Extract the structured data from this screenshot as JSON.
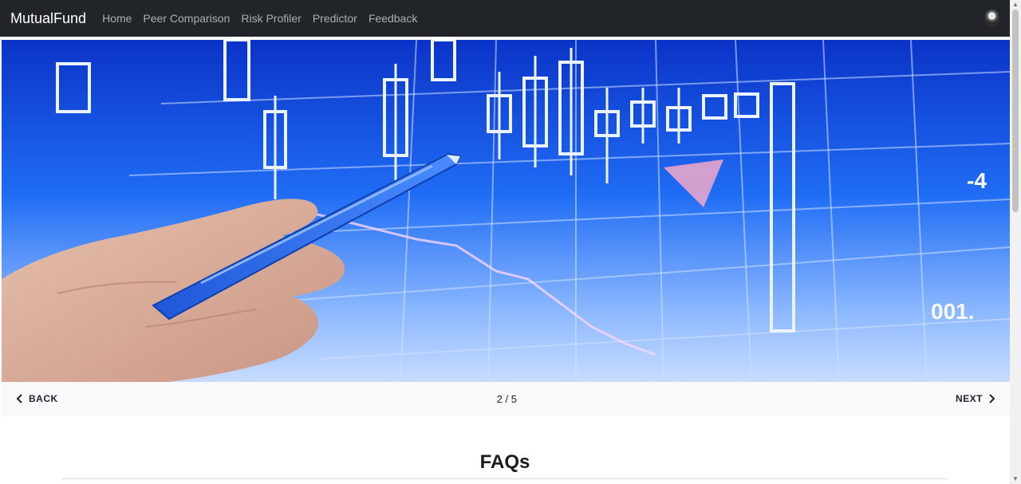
{
  "navbar": {
    "brand": "MutualFund",
    "links": [
      "Home",
      "Peer Comparison",
      "Risk Profiler",
      "Predictor",
      "Feedback"
    ]
  },
  "carousel": {
    "back_label": "BACK",
    "next_label": "NEXT",
    "counter": "2 / 5",
    "overlay_texts": [
      "-4",
      "001."
    ]
  },
  "section": {
    "title": "FAQs"
  },
  "colors": {
    "navbar_bg": "#212529",
    "hero_blue": "#1b66f2",
    "controls_bg": "#f8f9fa"
  }
}
